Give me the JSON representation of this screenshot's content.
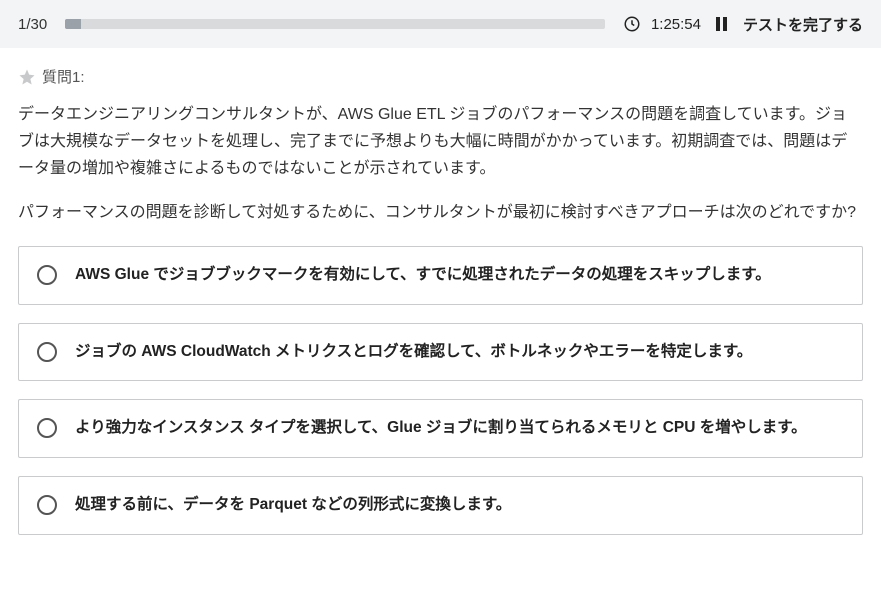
{
  "topbar": {
    "progress": "1/30",
    "timer": "1:25:54",
    "finish_label": "テストを完了する"
  },
  "question": {
    "label": "質問1:",
    "body_p1": "データエンジニアリングコンサルタントが、AWS Glue ETL ジョブのパフォーマンスの問題を調査しています。ジョブは大規模なデータセットを処理し、完了までに予想よりも大幅に時間がかかっています。初期調査では、問題はデータ量の増加や複雑さによるものではないことが示されています。",
    "body_p2": "パフォーマンスの問題を診断して対処するために、コンサルタントが最初に検討すべきアプローチは次のどれですか?"
  },
  "options": [
    {
      "text": "AWS Glue でジョブブックマークを有効にして、すでに処理されたデータの処理をスキップします。"
    },
    {
      "text": "ジョブの AWS CloudWatch メトリクスとログを確認して、ボトルネックやエラーを特定します。"
    },
    {
      "text": "より強力なインスタンス タイプを選択して、Glue ジョブに割り当てられるメモリと CPU を増やします。"
    },
    {
      "text": "処理する前に、データを Parquet などの列形式に変換します。"
    }
  ]
}
